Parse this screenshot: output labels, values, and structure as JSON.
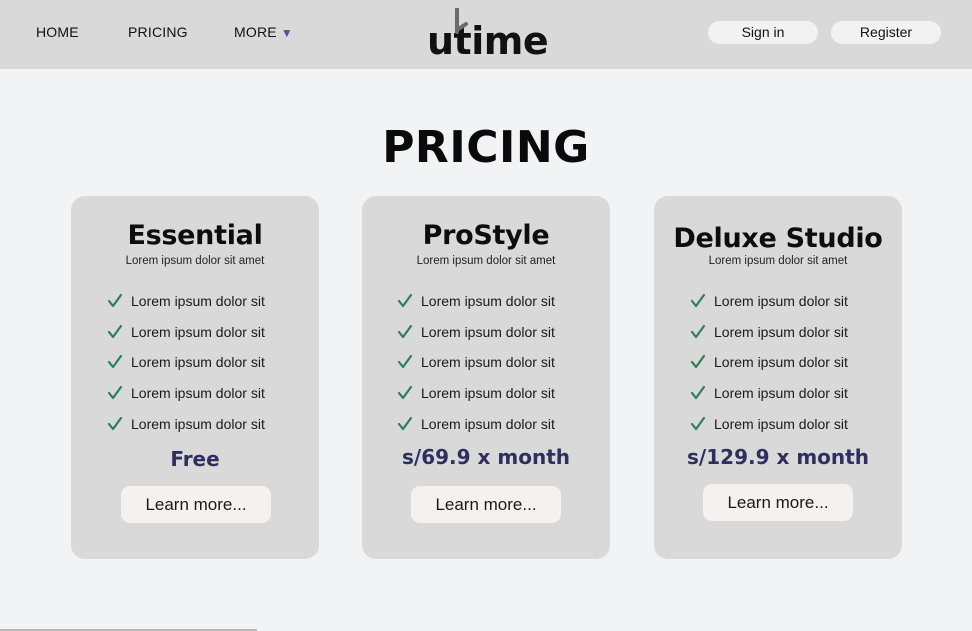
{
  "nav": {
    "home": "HOME",
    "pricing": "PRICING",
    "more": "MORE",
    "more_caret": "▼"
  },
  "logo": {
    "text": "utime"
  },
  "auth": {
    "signin": "Sign in",
    "register": "Register"
  },
  "page_title": "PRICING",
  "plans": [
    {
      "name": "Essential",
      "subtitle": "Lorem ipsum dolor sit amet",
      "features": [
        "Lorem ipsum dolor sit",
        "Lorem ipsum dolor sit",
        "Lorem ipsum dolor sit",
        "Lorem ipsum dolor sit",
        "Lorem ipsum dolor sit"
      ],
      "price": "Free",
      "button": "Learn more..."
    },
    {
      "name": "ProStyle",
      "subtitle": "Lorem ipsum dolor sit amet",
      "features": [
        "Lorem ipsum dolor sit",
        "Lorem ipsum dolor sit",
        "Lorem ipsum dolor sit",
        "Lorem ipsum dolor sit",
        "Lorem ipsum dolor sit"
      ],
      "price": "s/69.9 x month",
      "button": "Learn more..."
    },
    {
      "name": "Deluxe Studio",
      "subtitle": "Lorem ipsum dolor sit amet",
      "features": [
        "Lorem ipsum dolor sit",
        "Lorem ipsum dolor sit",
        "Lorem ipsum dolor sit",
        "Lorem ipsum dolor sit",
        "Lorem ipsum dolor sit"
      ],
      "price": "s/129.9 x month",
      "button": "Learn more..."
    }
  ],
  "colors": {
    "header_bg": "#d9d9d9",
    "page_bg": "#f2f3f5",
    "card_bg": "#d9d9d9",
    "price_color": "#2e2f5e",
    "check_color": "#2e7d5b",
    "caret_color": "#4b4fa0"
  },
  "icons": {
    "check": "check-icon",
    "caret": "caret-down-icon"
  }
}
